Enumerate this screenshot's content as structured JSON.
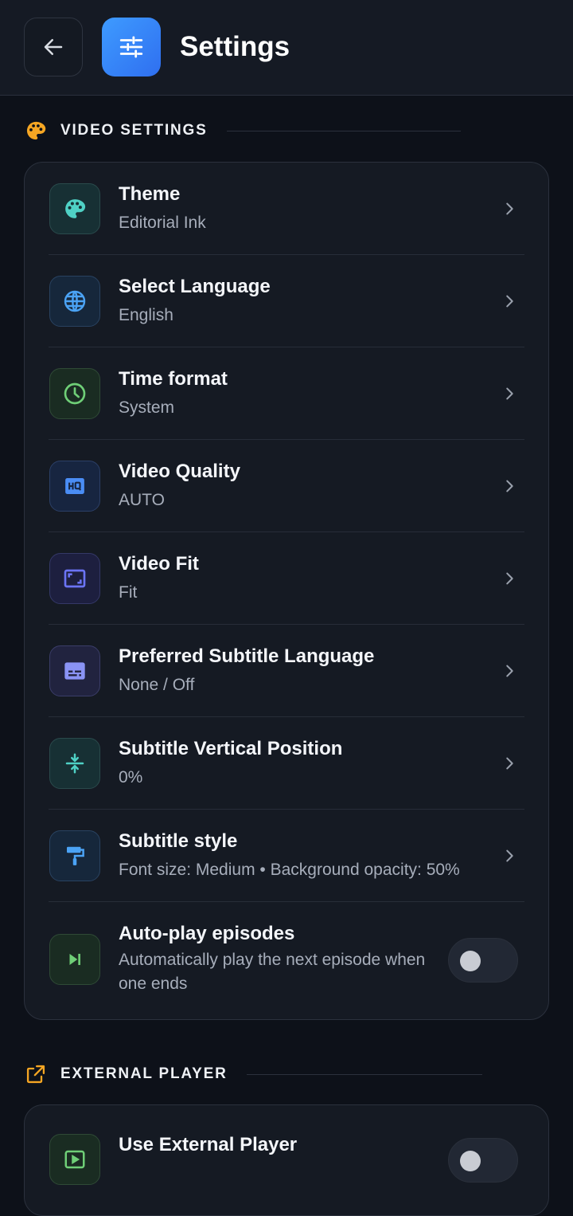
{
  "header": {
    "title": "Settings",
    "back_icon": "arrow-left-icon",
    "app_icon": "sliders-icon"
  },
  "sections": {
    "video": {
      "label": "VIDEO SETTINGS",
      "icon": "palette-icon",
      "icon_color": "#f5a623",
      "items": [
        {
          "title": "Theme",
          "value": "Editorial Ink",
          "icon": "palette-icon",
          "color": "#4fd1c5"
        },
        {
          "title": "Select Language",
          "value": "English",
          "icon": "globe-icon",
          "color": "#4ba3f5"
        },
        {
          "title": "Time format",
          "value": "System",
          "icon": "clock-icon",
          "color": "#6fcf77"
        },
        {
          "title": "Video Quality",
          "value": "AUTO",
          "icon": "hq-icon",
          "color": "#4a8df5"
        },
        {
          "title": "Video Fit",
          "value": "Fit",
          "icon": "aspect-ratio-icon",
          "color": "#6b74f5"
        },
        {
          "title": "Preferred Subtitle Language",
          "value": "None / Off",
          "icon": "subtitles-icon",
          "color": "#8a93f5"
        },
        {
          "title": "Subtitle Vertical Position",
          "value": "0%",
          "icon": "vertical-align-center-icon",
          "color": "#4fd1c5"
        },
        {
          "title": "Subtitle style",
          "value": "Font size: Medium • Background opacity: 50%",
          "icon": "paint-roller-icon",
          "color": "#4ba3f5"
        },
        {
          "title": "Auto-play episodes",
          "value": "Automatically play the next episode when one ends",
          "icon": "skip-next-icon",
          "color": "#6fcf77",
          "toggle": false
        }
      ]
    },
    "external": {
      "label": "EXTERNAL PLAYER",
      "icon": "open-in-new-icon",
      "icon_color": "#f5a623",
      "items": [
        {
          "title": "Use External Player",
          "icon": "external-player-icon",
          "color": "#6fcf77",
          "toggle": false
        }
      ]
    }
  }
}
